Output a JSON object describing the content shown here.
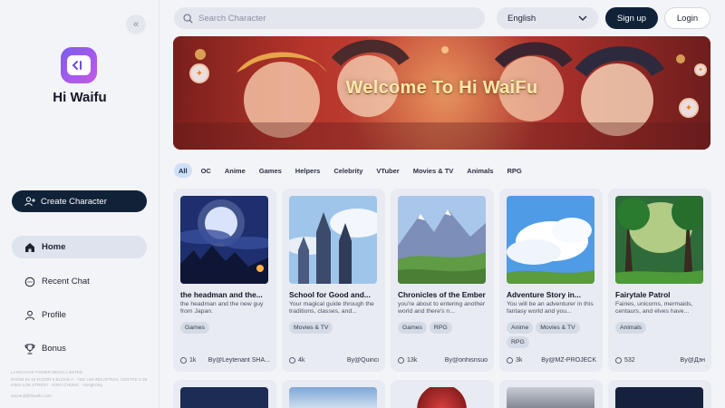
{
  "sidebar": {
    "app_name": "Hi Waifu",
    "collapse_icon": "double-chevron-left-icon",
    "create_label": "Create Character",
    "nav": [
      {
        "label": "Home",
        "icon": "home-icon",
        "active": true
      },
      {
        "label": "Recent Chat",
        "icon": "chat-bubble-icon",
        "active": false
      },
      {
        "label": "Profile",
        "icon": "user-icon",
        "active": false
      },
      {
        "label": "Bonus",
        "icon": "trophy-icon",
        "active": false
      }
    ],
    "footer_company": "LANGUAGE POWER MEDIA LIMITED",
    "footer_address": "ROOM 61-10 FLOOR 5 BLOCK A · YEE LIM INDUSTRIAL CENTRE 2-28 KWAI LOK STREET · KWAI CHUNG · HongKong",
    "footer_email": "taoyanji@hiwaifu.com"
  },
  "header": {
    "search_placeholder": "Search Character",
    "language": "English",
    "signup_label": "Sign up",
    "login_label": "Login"
  },
  "banner": {
    "title": "Welcome To Hi WaiFu"
  },
  "filters": [
    "All",
    "OC",
    "Anime",
    "Games",
    "Helpers",
    "Celebrity",
    "VTuber",
    "Movies & TV",
    "Animals",
    "RPG"
  ],
  "active_filter": "All",
  "cards": [
    {
      "title": "the headman and the...",
      "description": "the headman and the new guy from Japan.",
      "tags": [
        "Games"
      ],
      "chats": "1k",
      "author": "By@Leytenant SHA..."
    },
    {
      "title": "School for Good and...",
      "description": "Your magical guide through the traditions, classes, and...",
      "tags": [
        "Movies & TV"
      ],
      "chats": "4k",
      "author": "By@Quinci"
    },
    {
      "title": "Chronicles of the Ember",
      "description": "you're about to entering another world and there's n...",
      "tags": [
        "Games",
        "RPG"
      ],
      "chats": "13k",
      "author": "By@onhisnsuo"
    },
    {
      "title": "Adventure Story in...",
      "description": "You will be an adventurer in this fantasy world and you...",
      "tags": [
        "Anime",
        "Movies & TV",
        "RPG"
      ],
      "chats": "3k",
      "author": "By@MZ-PROJECK"
    },
    {
      "title": "Fairytale Patrol",
      "description": "Fairies, unicorns, mermaids, centaurs, and elves have...",
      "tags": [
        "Animals"
      ],
      "chats": "532",
      "author": "By@Дэн"
    }
  ],
  "colors": {
    "primary_dark": "#0f2238",
    "page_bg": "#f3f4f8",
    "card_bg": "#e9ebf2",
    "active_tag": "#cfe0f6"
  }
}
